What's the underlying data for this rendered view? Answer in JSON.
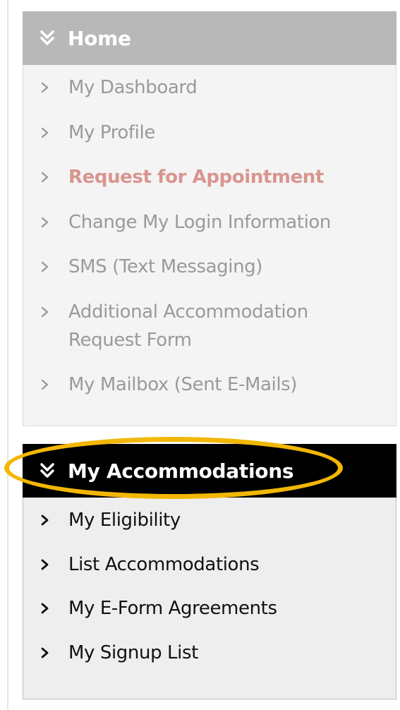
{
  "home_panel": {
    "title": "Home",
    "icon": "double-chevron-down-icon",
    "header_bg": "#b8b8b8",
    "items": [
      {
        "label": "My Dashboard",
        "active": false
      },
      {
        "label": "My Profile",
        "active": false
      },
      {
        "label": "Request for Appointment",
        "active": true
      },
      {
        "label": "Change My Login Information",
        "active": false
      },
      {
        "label": "SMS (Text Messaging)",
        "active": false
      },
      {
        "label": "Additional Accommodation Request Form",
        "active": false
      },
      {
        "label": "My Mailbox (Sent E-Mails)",
        "active": false
      }
    ]
  },
  "accommodations_panel": {
    "title": "My Accommodations",
    "icon": "double-chevron-down-icon",
    "header_bg": "#000000",
    "highlighted": true,
    "highlight_color": "#f2b705",
    "items": [
      {
        "label": "My Eligibility"
      },
      {
        "label": "List Accommodations"
      },
      {
        "label": "My E-Form Agreements"
      },
      {
        "label": "My Signup List"
      }
    ]
  },
  "colors": {
    "inactive_text": "#9a9a9a",
    "active_text": "#d9958f",
    "dark_text": "#111111"
  }
}
